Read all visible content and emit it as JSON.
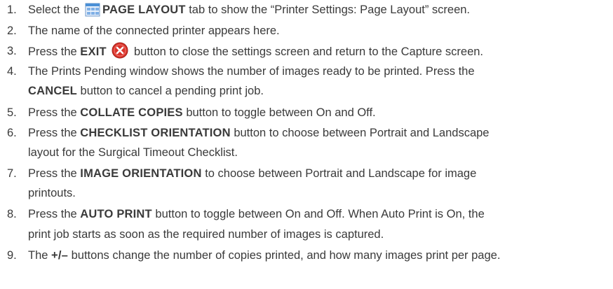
{
  "items": [
    {
      "num": "1.",
      "l1a": "Select the",
      "l1b": "PAGE LAYOUT",
      "l1c": "tab to show the “Printer Settings: Page Layout” screen.",
      "icon": "page-layout-icon"
    },
    {
      "num": "2.",
      "l1a": "The name of the connected printer appears here."
    },
    {
      "num": "3.",
      "l1a": "Press the",
      "l1b": "EXIT",
      "l1c": "button to close the settings screen and return to the Capture screen.",
      "icon": "exit-icon"
    },
    {
      "num": "4.",
      "l1a": "The Prints Pending window shows the number of images ready to be printed. Press the",
      "l2b": "CANCEL",
      "l2c": "button to cancel a pending print job."
    },
    {
      "num": "5.",
      "l1a": "Press the",
      "l1b": "COLLATE COPIES",
      "l1c": "button to toggle between On and Off."
    },
    {
      "num": "6.",
      "l1a": "Press the",
      "l1b": "CHECKLIST ORIENTATION",
      "l1c": "button to choose between Portrait and Landscape",
      "l2a": "layout for the Surgical Timeout Checklist."
    },
    {
      "num": "7.",
      "l1a": "Press the",
      "l1b": "IMAGE ORIENTATION",
      "l1c": "to choose between Portrait and Landscape for image",
      "l2a": "printouts."
    },
    {
      "num": "8.",
      "l1a": "Press the",
      "l1b": "AUTO PRINT",
      "l1c": "button to toggle between On and Off. When Auto Print is On, the",
      "l2a": "print job starts as soon as the required number of images is captured."
    },
    {
      "num": "9.",
      "l1a": "The",
      "l1b": "+/–",
      "l1c": "buttons change the number of copies printed, and how many images print per page."
    }
  ],
  "colors": {
    "text": "#3a3a3a",
    "exit_red": "#d9342b",
    "icon_blue": "#4a8fd6"
  }
}
